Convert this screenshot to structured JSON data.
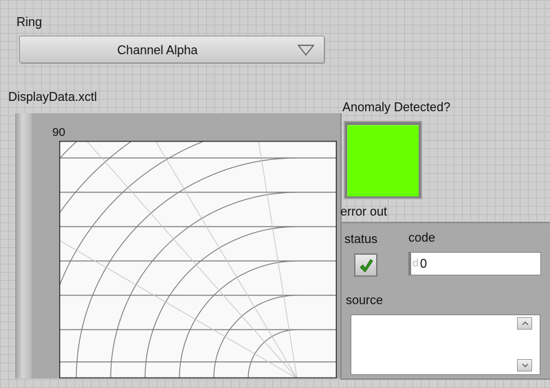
{
  "ring": {
    "label": "Ring",
    "value": "Channel Alpha"
  },
  "display": {
    "label": "DisplayData.xctl",
    "scale_label": "90"
  },
  "anomaly": {
    "label": "Anomaly Detected?",
    "state": true,
    "color": "#66ff00"
  },
  "error_out": {
    "label": "error out",
    "status_label": "status",
    "status_icon": "checkmark-icon",
    "code_label": "code",
    "code_radix": "d",
    "code_value": "0",
    "source_label": "source",
    "source_value": ""
  }
}
